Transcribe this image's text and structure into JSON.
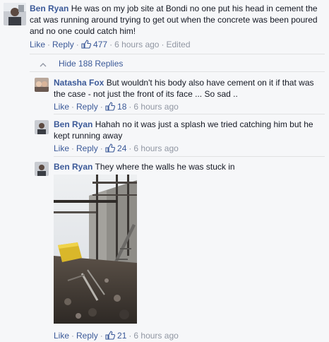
{
  "comments": [
    {
      "author": "Ben Ryan",
      "text": "He was on my job site at Bondi no one put his head in cement the cat was running around trying to get out when the concrete was been poured and no one could catch him!",
      "like_label": "Like",
      "reply_label": "Reply",
      "likes": "477",
      "time": "6 hours ago",
      "edited": "Edited"
    },
    {
      "author": "Natasha Fox",
      "text": "But wouldn't his body also have cement on it if that was the case - not just the front of its face ... So sad ..",
      "like_label": "Like",
      "reply_label": "Reply",
      "likes": "18",
      "time": "6 hours ago"
    },
    {
      "author": "Ben Ryan",
      "text": "Hahah no it was just a splash we tried catching him but he kept running away",
      "like_label": "Like",
      "reply_label": "Reply",
      "likes": "24",
      "time": "6 hours ago"
    },
    {
      "author": "Ben Ryan",
      "text": "They where the walls he was stuck in",
      "like_label": "Like",
      "reply_label": "Reply",
      "likes": "21",
      "time": "6 hours ago"
    }
  ],
  "hide_replies_label": "Hide 188 Replies",
  "colors": {
    "link": "#3b5998",
    "meta": "#9197a3",
    "background": "#f6f7f9"
  },
  "icons": {
    "like": "thumbs-up-icon",
    "caret": "caret-up-icon"
  }
}
